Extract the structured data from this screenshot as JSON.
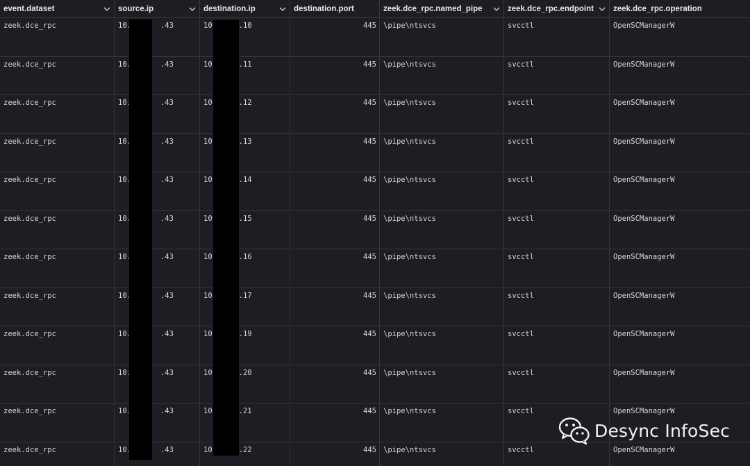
{
  "columns": [
    {
      "id": "event_dataset",
      "label": "event.dataset"
    },
    {
      "id": "source_ip",
      "label": "source.ip"
    },
    {
      "id": "destination_ip",
      "label": "destination.ip"
    },
    {
      "id": "destination_port",
      "label": "destination.port"
    },
    {
      "id": "named_pipe",
      "label": "zeek.dce_rpc.named_pipe"
    },
    {
      "id": "endpoint",
      "label": "zeek.dce_rpc.endpoint"
    },
    {
      "id": "operation",
      "label": "zeek.dce_rpc.operation"
    }
  ],
  "rows": [
    {
      "event_dataset": "zeek.dce_rpc",
      "source_ip_prefix": "10.",
      "source_ip_suffix": ".43",
      "destination_ip_prefix": "10",
      "destination_ip_suffix": ".10",
      "destination_port": "445",
      "named_pipe": "\\pipe\\ntsvcs",
      "endpoint": "svcctl",
      "operation": "OpenSCManagerW"
    },
    {
      "event_dataset": "zeek.dce_rpc",
      "source_ip_prefix": "10.",
      "source_ip_suffix": ".43",
      "destination_ip_prefix": "10",
      "destination_ip_suffix": ".11",
      "destination_port": "445",
      "named_pipe": "\\pipe\\ntsvcs",
      "endpoint": "svcctl",
      "operation": "OpenSCManagerW"
    },
    {
      "event_dataset": "zeek.dce_rpc",
      "source_ip_prefix": "10.",
      "source_ip_suffix": ".43",
      "destination_ip_prefix": "10",
      "destination_ip_suffix": ".12",
      "destination_port": "445",
      "named_pipe": "\\pipe\\ntsvcs",
      "endpoint": "svcctl",
      "operation": "OpenSCManagerW"
    },
    {
      "event_dataset": "zeek.dce_rpc",
      "source_ip_prefix": "10.",
      "source_ip_suffix": ".43",
      "destination_ip_prefix": "10",
      "destination_ip_suffix": ".13",
      "destination_port": "445",
      "named_pipe": "\\pipe\\ntsvcs",
      "endpoint": "svcctl",
      "operation": "OpenSCManagerW"
    },
    {
      "event_dataset": "zeek.dce_rpc",
      "source_ip_prefix": "10.",
      "source_ip_suffix": ".43",
      "destination_ip_prefix": "10",
      "destination_ip_suffix": ".14",
      "destination_port": "445",
      "named_pipe": "\\pipe\\ntsvcs",
      "endpoint": "svcctl",
      "operation": "OpenSCManagerW"
    },
    {
      "event_dataset": "zeek.dce_rpc",
      "source_ip_prefix": "10.",
      "source_ip_suffix": ".43",
      "destination_ip_prefix": "10",
      "destination_ip_suffix": ".15",
      "destination_port": "445",
      "named_pipe": "\\pipe\\ntsvcs",
      "endpoint": "svcctl",
      "operation": "OpenSCManagerW"
    },
    {
      "event_dataset": "zeek.dce_rpc",
      "source_ip_prefix": "10.",
      "source_ip_suffix": ".43",
      "destination_ip_prefix": "10",
      "destination_ip_suffix": ".16",
      "destination_port": "445",
      "named_pipe": "\\pipe\\ntsvcs",
      "endpoint": "svcctl",
      "operation": "OpenSCManagerW"
    },
    {
      "event_dataset": "zeek.dce_rpc",
      "source_ip_prefix": "10.",
      "source_ip_suffix": ".43",
      "destination_ip_prefix": "10",
      "destination_ip_suffix": ".17",
      "destination_port": "445",
      "named_pipe": "\\pipe\\ntsvcs",
      "endpoint": "svcctl",
      "operation": "OpenSCManagerW"
    },
    {
      "event_dataset": "zeek.dce_rpc",
      "source_ip_prefix": "10.",
      "source_ip_suffix": ".43",
      "destination_ip_prefix": "10",
      "destination_ip_suffix": ".19",
      "destination_port": "445",
      "named_pipe": "\\pipe\\ntsvcs",
      "endpoint": "svcctl",
      "operation": "OpenSCManagerW"
    },
    {
      "event_dataset": "zeek.dce_rpc",
      "source_ip_prefix": "10.",
      "source_ip_suffix": ".43",
      "destination_ip_prefix": "10",
      "destination_ip_suffix": ".20",
      "destination_port": "445",
      "named_pipe": "\\pipe\\ntsvcs",
      "endpoint": "svcctl",
      "operation": "OpenSCManagerW"
    },
    {
      "event_dataset": "zeek.dce_rpc",
      "source_ip_prefix": "10.",
      "source_ip_suffix": ".43",
      "destination_ip_prefix": "10",
      "destination_ip_suffix": ".21",
      "destination_port": "445",
      "named_pipe": "\\pipe\\ntsvcs",
      "endpoint": "svcctl",
      "operation": "OpenSCManagerW"
    },
    {
      "event_dataset": "zeek.dce_rpc",
      "source_ip_prefix": "10.",
      "source_ip_suffix": ".43",
      "destination_ip_prefix": "10",
      "destination_ip_suffix": ".22",
      "destination_port": "445",
      "named_pipe": "\\pipe\\ntsvcs",
      "endpoint": "svcctl",
      "operation": "OpenSCManagerW"
    }
  ],
  "watermark": {
    "text": "Desync InfoSec",
    "icon": "wechat-logo-icon"
  },
  "icons": {
    "column_menu": "chevron-down-icon"
  },
  "colors": {
    "background": "#1d1e24",
    "gridline": "#34363d",
    "text": "#d4d6dc",
    "header_text": "#e6e8ec",
    "redaction": "#000000"
  }
}
